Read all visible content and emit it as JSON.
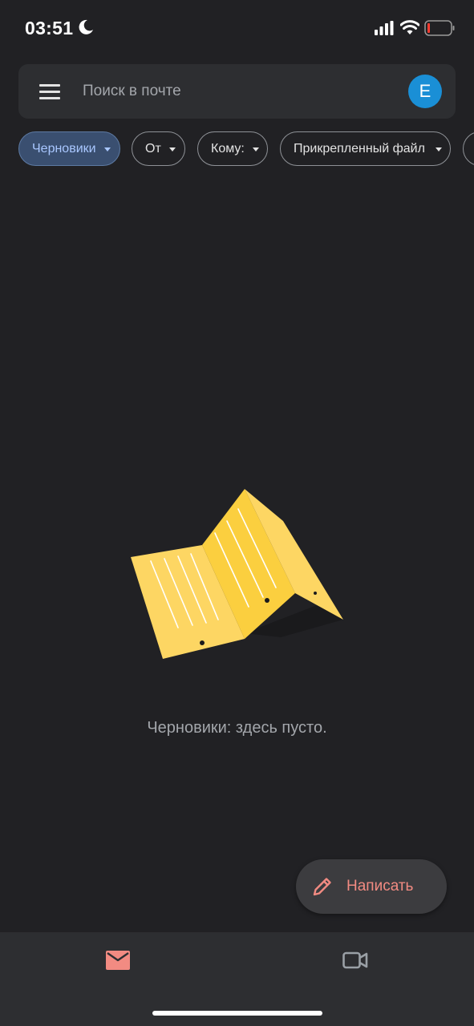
{
  "status_bar": {
    "time": "03:51"
  },
  "search": {
    "placeholder": "Поиск в почте",
    "avatar_letter": "E"
  },
  "chips": [
    {
      "label": "Черновики",
      "active": true
    },
    {
      "label": "От",
      "active": false
    },
    {
      "label": "Кому:",
      "active": false
    },
    {
      "label": "Прикрепленный файл",
      "active": false
    }
  ],
  "empty_state": {
    "message": "Черновики: здесь пусто."
  },
  "compose": {
    "label": "Написать"
  },
  "colors": {
    "background": "#212124",
    "surface": "#2d2e31",
    "active_chip": "#3a4f70",
    "accent_red": "#f28b82",
    "avatar_blue": "#1a8fd6",
    "illustration_yellow": "#fdd663"
  },
  "icons": {
    "menu": "menu-icon",
    "compose": "pencil-icon",
    "mail": "mail-icon",
    "meet": "video-camera-icon"
  }
}
